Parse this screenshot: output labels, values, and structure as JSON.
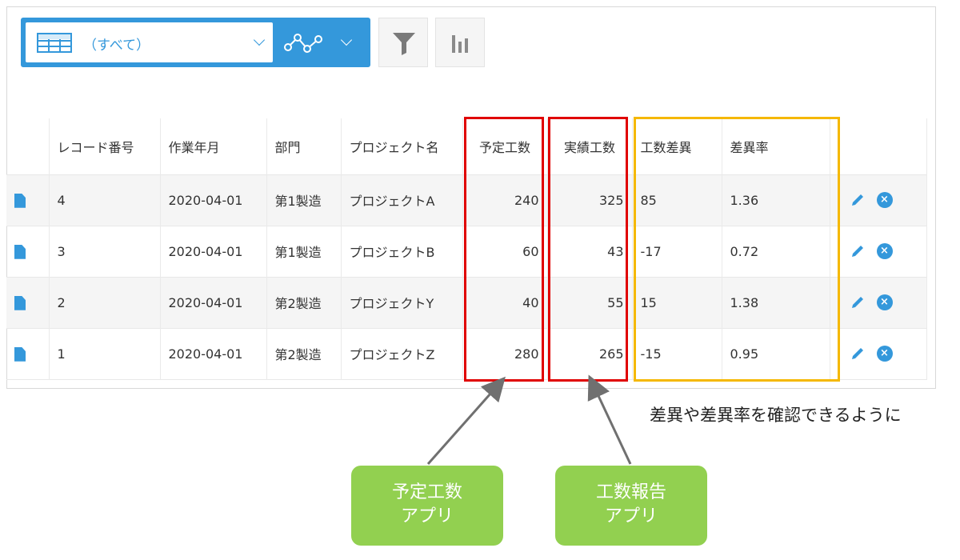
{
  "toolbar": {
    "view_label": "（すべて）",
    "icons": {
      "view": "table-icon",
      "graph": "graph-icon",
      "filter": "filter-icon",
      "chart": "bar-chart-icon"
    }
  },
  "table": {
    "headers": [
      "",
      "レコード番号",
      "作業年月",
      "部門",
      "プロジェクト名",
      "予定工数",
      "実績工数",
      "工数差異",
      "差異率",
      ""
    ],
    "rows": [
      {
        "record_no": "4",
        "month": "2020-04-01",
        "dept": "第1製造",
        "project": "プロジェクトA",
        "planned": "240",
        "actual": "325",
        "diff": "85",
        "rate": "1.36"
      },
      {
        "record_no": "3",
        "month": "2020-04-01",
        "dept": "第1製造",
        "project": "プロジェクトB",
        "planned": "60",
        "actual": "43",
        "diff": "-17",
        "rate": "0.72"
      },
      {
        "record_no": "2",
        "month": "2020-04-01",
        "dept": "第2製造",
        "project": "プロジェクトY",
        "planned": "40",
        "actual": "55",
        "diff": "15",
        "rate": "1.38"
      },
      {
        "record_no": "1",
        "month": "2020-04-01",
        "dept": "第2製造",
        "project": "プロジェクトZ",
        "planned": "280",
        "actual": "265",
        "diff": "-15",
        "rate": "0.95"
      }
    ]
  },
  "annotations": {
    "note": "差異や差異率を確認できるように",
    "callout_plan": {
      "line1": "予定工数",
      "line2": "アプリ"
    },
    "callout_report": {
      "line1": "工数報告",
      "line2": "アプリ"
    }
  },
  "colors": {
    "accent": "#3498db",
    "highlight_red": "#e00000",
    "highlight_yellow": "#f5b800",
    "callout_green": "#92d050"
  }
}
